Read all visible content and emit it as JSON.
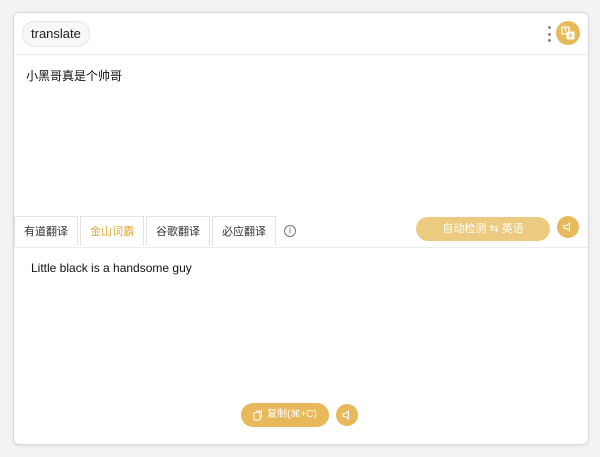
{
  "header": {
    "title": "translate",
    "more_icon": "more-vertical-icon",
    "app_icon": "translate-app-icon"
  },
  "source": {
    "text": "小黑哥真是个帅哥"
  },
  "tabs": [
    {
      "label": "有道翻译",
      "active": false
    },
    {
      "label": "金山词霸",
      "active": true
    },
    {
      "label": "谷歌翻译",
      "active": false
    },
    {
      "label": "必应翻译",
      "active": false
    }
  ],
  "info_icon": "info-icon",
  "language_button": {
    "label": "自动检测 ⇆ 英语"
  },
  "result": {
    "text": "Little black is a handsome guy"
  },
  "copy_button": {
    "label": "复制(⌘+C)"
  },
  "colors": {
    "accent": "#e8b95a",
    "active_tab_text": "#e2a93e"
  }
}
